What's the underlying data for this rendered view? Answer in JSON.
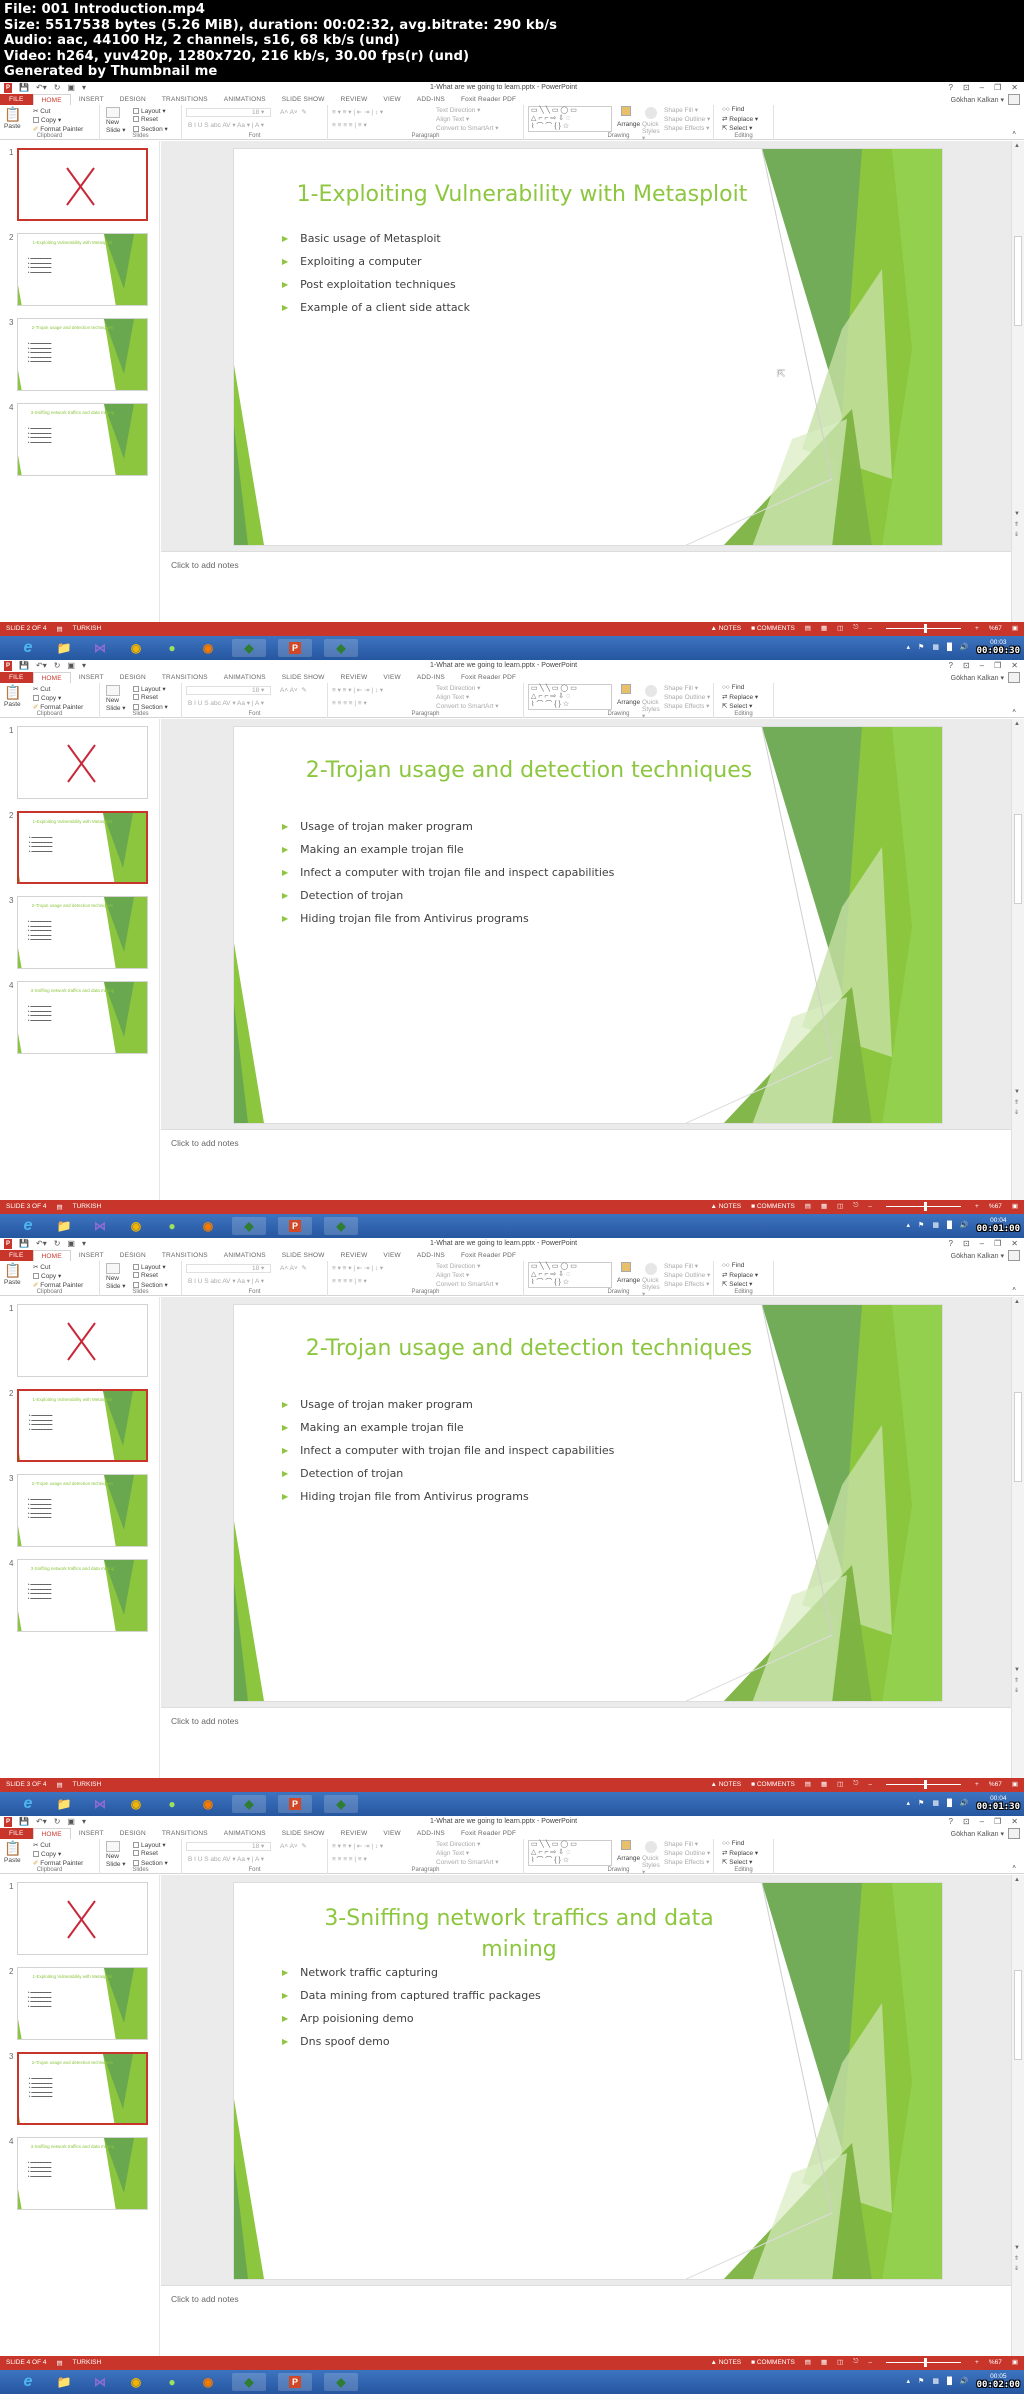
{
  "header": {
    "file": "File: 001 Introduction.mp4",
    "size": "Size: 5517538 bytes (5.26 MiB), duration: 00:02:32, avg.bitrate: 290 kb/s",
    "audio": "Audio: aac, 44100 Hz, 2 channels, s16, 68 kb/s (und)",
    "video": "Video: h264, yuv420p, 1280x720, 216 kb/s, 30.00 fps(r) (und)",
    "generator": "Generated by Thumbnail me"
  },
  "app": {
    "doc_title": "1-What are we going to learn.pptx - PowerPoint",
    "window_controls": [
      "?",
      "⊡",
      "–",
      "❐",
      "✕"
    ],
    "user_name": "Gökhan Kalkan ▾",
    "tabs": [
      "FILE",
      "HOME",
      "INSERT",
      "DESIGN",
      "TRANSITIONS",
      "ANIMATIONS",
      "SLIDE SHOW",
      "REVIEW",
      "VIEW",
      "ADD-INS",
      "Foxit Reader PDF"
    ],
    "ribbon": {
      "clipboard": {
        "label": "Clipboard",
        "paste": "Paste",
        "cut": "Cut",
        "copy": "Copy ▾",
        "format_painter": "Format Painter"
      },
      "slides": {
        "label": "Slides",
        "new_slide": "New Slide ▾",
        "layout": "Layout ▾",
        "reset": "Reset",
        "section": "Section ▾"
      },
      "font": {
        "label": "Font",
        "size": "18",
        "format_row": "B  I  U  S  abc  AV ▾  Aa ▾  |  A ▾"
      },
      "paragraph": {
        "label": "Paragraph",
        "text_direction": "Text Direction ▾",
        "align_text": "Align Text ▾",
        "convert_smartart": "Convert to SmartArt ▾"
      },
      "drawing": {
        "label": "Drawing",
        "arrange": "Arrange",
        "quick_styles": "Quick Styles ▾",
        "shape_fill": "Shape Fill ▾",
        "shape_outline": "Shape Outline ▾",
        "shape_effects": "Shape Effects ▾"
      },
      "editing": {
        "label": "Editing",
        "find": "Find",
        "replace": "Replace ▾",
        "select": "Select ▾"
      }
    },
    "notes_placeholder": "Click to add notes",
    "status": {
      "notes": "NOTES",
      "comments": "COMMENTS",
      "zoom": "%67",
      "language": "TURKISH"
    },
    "thumb_numbers": [
      "1",
      "2",
      "3",
      "4"
    ]
  },
  "slides": [
    {
      "title": "1-Exploiting Vulnerability with Metasploit",
      "bullets": [
        "Basic usage of Metasploit",
        "Exploiting a computer",
        "Post exploitation techniques",
        "Example of a client side attack"
      ]
    },
    {
      "title": "2-Trojan usage and detection techniques",
      "bullets": [
        "Usage of trojan maker program",
        "Making an example trojan file",
        "Infect a computer with trojan file and inspect capabilities",
        "Detection of trojan",
        "Hiding trojan file from Antivirus programs"
      ]
    },
    {
      "title": "3-Sniffing network traffics and data mining",
      "bullets": [
        "Network traffic capturing",
        "Data mining from captured traffic packages",
        "Arp poisioning demo",
        "Dns spoof demo"
      ]
    }
  ],
  "frames": [
    {
      "slide_index": 1,
      "status_slide": "SLIDE 2 OF 4",
      "clock": "00:03",
      "video_time": "00:00:30"
    },
    {
      "slide_index": 2,
      "status_slide": "SLIDE 3 OF 4",
      "clock": "00:04",
      "video_time": "00:01:00"
    },
    {
      "slide_index": 2,
      "status_slide": "SLIDE 3 OF 4",
      "clock": "00:04",
      "video_time": "00:01:30"
    },
    {
      "slide_index": 3,
      "status_slide": "SLIDE 4 OF 4",
      "clock": "00:05",
      "video_time": "00:02:00"
    }
  ],
  "taskbar": [
    "internet-explorer",
    "file-explorer",
    "visual-studio",
    "chrome",
    "green-app",
    "firefox",
    "app-1",
    "powerpoint",
    "app-2"
  ],
  "colors": {
    "accent_red": "#c8352b",
    "slide_green": "#8dc63f",
    "taskbar_blue": "#2b5fa8"
  }
}
